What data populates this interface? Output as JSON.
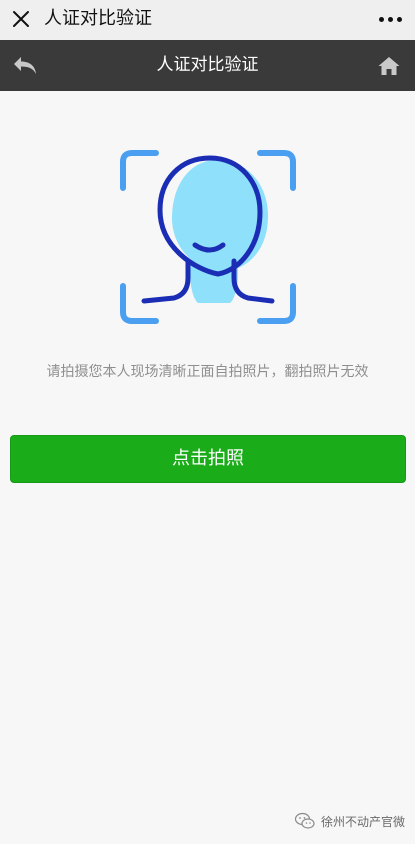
{
  "wechat_bar": {
    "title": "人证对比验证",
    "close_icon": "close-icon",
    "more_icon": "more-icon"
  },
  "nav": {
    "title": "人证对比验证",
    "back_icon": "back-arrow-icon",
    "home_icon": "home-icon"
  },
  "main": {
    "hint": "请拍摄您本人现场清晰正面自拍照片，翻拍照片无效",
    "capture_button_label": "点击拍照"
  },
  "watermark": {
    "text": "徐州不动产官微"
  },
  "colors": {
    "top_bar_bg": "#efefef",
    "nav_bg": "#3a3a3a",
    "button_green": "#1aad19",
    "frame_blue": "#4a9ff0",
    "face_fill": "#8fe0fa",
    "face_stroke": "#1a2db4"
  }
}
